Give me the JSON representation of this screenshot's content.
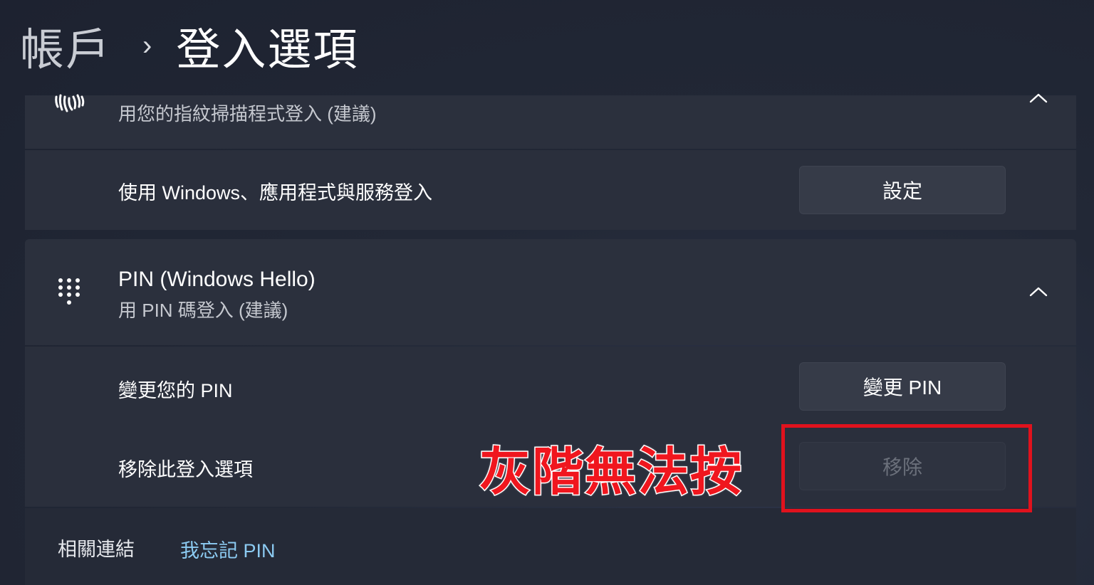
{
  "header": {
    "parent": "帳戶",
    "separator": "›",
    "current": "登入選項"
  },
  "fingerprint": {
    "description": "用您的指紋掃描程式登入 (建議)",
    "icon": "fingerprint-icon",
    "expanded": true,
    "setup_row_label": "使用 Windows、應用程式與服務登入",
    "setup_button": "設定"
  },
  "pin": {
    "title": "PIN (Windows Hello)",
    "description": "用 PIN 碼登入 (建議)",
    "icon": "pin-keypad-icon",
    "expanded": true,
    "change_row_label": "變更您的 PIN",
    "change_button": "變更 PIN",
    "remove_row_label": "移除此登入選項",
    "remove_button": "移除",
    "remove_button_disabled": true
  },
  "related": {
    "label": "相關連結",
    "link": "我忘記 PIN"
  },
  "annotation": {
    "text": "灰階無法按",
    "color": "#e0121d"
  }
}
